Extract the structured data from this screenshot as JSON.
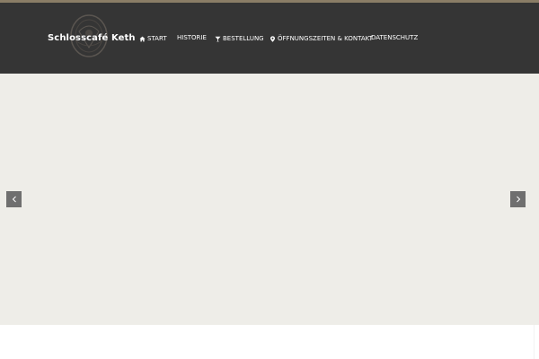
{
  "site": {
    "brand_name": "Schlosscafé Keth",
    "accent_color": "#8a7d66",
    "header_color": "#353535",
    "slider_color": "#eeede8"
  },
  "nav": {
    "items": [
      {
        "label": "START",
        "icon": "home-icon"
      },
      {
        "label": "HISTORIE",
        "icon": null
      },
      {
        "label": "BESTELLUNG",
        "icon": "cocktail-glass-icon"
      },
      {
        "label": "ÖFFNUNGSZEITEN & KONTAKT",
        "icon": "map-pin-icon"
      },
      {
        "label": "DATENSCHUTZ",
        "icon": null
      }
    ]
  },
  "slider": {
    "prev_icon": "chevron-left-icon",
    "next_icon": "chevron-right-icon"
  }
}
